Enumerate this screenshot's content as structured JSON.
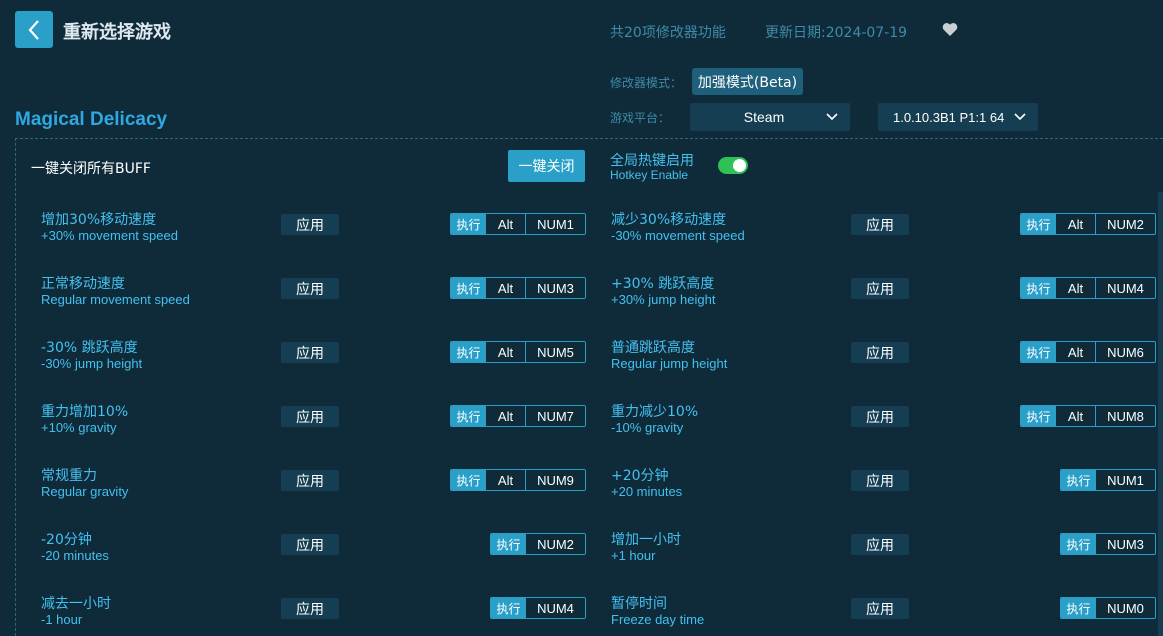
{
  "header": {
    "title": "重新选择游戏",
    "features_count": "共20项修改器功能",
    "update_date": "更新日期:2024-07-19"
  },
  "settings": {
    "mode_label": "修改器模式：",
    "mode_value": "加强模式(Beta)",
    "platform_label": "游戏平台：",
    "platform_value": "Steam",
    "version_value": "1.0.10.3B1 P1:1 64"
  },
  "game": {
    "title": "Magical Delicacy"
  },
  "buff": {
    "label": "一键关闭所有BUFF",
    "button": "一键关闭",
    "hotkey_cn": "全局热键启用",
    "hotkey_en": "Hotkey Enable",
    "hotkey_enabled": true
  },
  "apply_label": "应用",
  "exec_label": "执行",
  "cheats": [
    {
      "cn": "增加30%移动速度",
      "en": "+30% movement speed",
      "mod": "Alt",
      "key": "NUM1"
    },
    {
      "cn": "减少30%移动速度",
      "en": "-30% movement speed",
      "mod": "Alt",
      "key": "NUM2"
    },
    {
      "cn": "正常移动速度",
      "en": "Regular movement speed",
      "mod": "Alt",
      "key": "NUM3"
    },
    {
      "cn": "+30% 跳跃高度",
      "en": "+30% jump height",
      "mod": "Alt",
      "key": "NUM4"
    },
    {
      "cn": "-30% 跳跃高度",
      "en": "-30% jump height",
      "mod": "Alt",
      "key": "NUM5"
    },
    {
      "cn": "普通跳跃高度",
      "en": "Regular jump height",
      "mod": "Alt",
      "key": "NUM6"
    },
    {
      "cn": "重力增加10%",
      "en": "+10% gravity",
      "mod": "Alt",
      "key": "NUM7"
    },
    {
      "cn": "重力减少10%",
      "en": "-10% gravity",
      "mod": "Alt",
      "key": "NUM8"
    },
    {
      "cn": "常规重力",
      "en": "Regular gravity",
      "mod": "Alt",
      "key": "NUM9"
    },
    {
      "cn": "+20分钟",
      "en": "+20 minutes",
      "mod": "",
      "key": "NUM1"
    },
    {
      "cn": "-20分钟",
      "en": "-20 minutes",
      "mod": "",
      "key": "NUM2"
    },
    {
      "cn": "增加一小时",
      "en": "+1 hour",
      "mod": "",
      "key": "NUM3"
    },
    {
      "cn": "减去一小时",
      "en": "-1 hour",
      "mod": "",
      "key": "NUM4"
    },
    {
      "cn": "暂停时间",
      "en": "Freeze day time",
      "mod": "",
      "key": "NUM0"
    }
  ]
}
